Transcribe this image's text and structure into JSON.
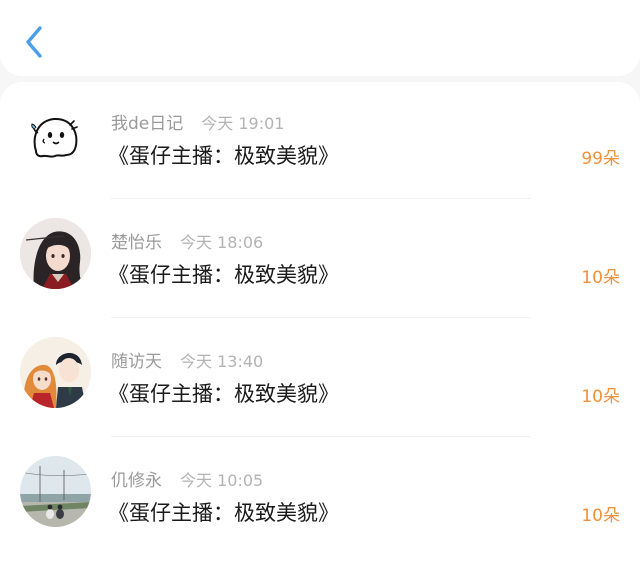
{
  "header": {
    "back_icon": "chevron-left-icon",
    "accent": "#4a9fe8"
  },
  "list": {
    "count_color": "#f0913c",
    "items": [
      {
        "name": "我de日记",
        "time": "今天 19:01",
        "title": "《蛋仔主播：极致美貌》",
        "count": "99朵",
        "avatar": "ghost-sticker"
      },
      {
        "name": "楚怡乐",
        "time": "今天 18:06",
        "title": "《蛋仔主播：极致美貌》",
        "count": "10朵",
        "avatar": "anime-girl-dark-hair"
      },
      {
        "name": "随访天",
        "time": "今天 13:40",
        "title": "《蛋仔主播：极致美貌》",
        "count": "10朵",
        "avatar": "anime-couple"
      },
      {
        "name": "仉修永",
        "time": "今天 10:05",
        "title": "《蛋仔主播：极致美貌》",
        "count": "10朵",
        "avatar": "landscape-couple-photo"
      }
    ]
  }
}
